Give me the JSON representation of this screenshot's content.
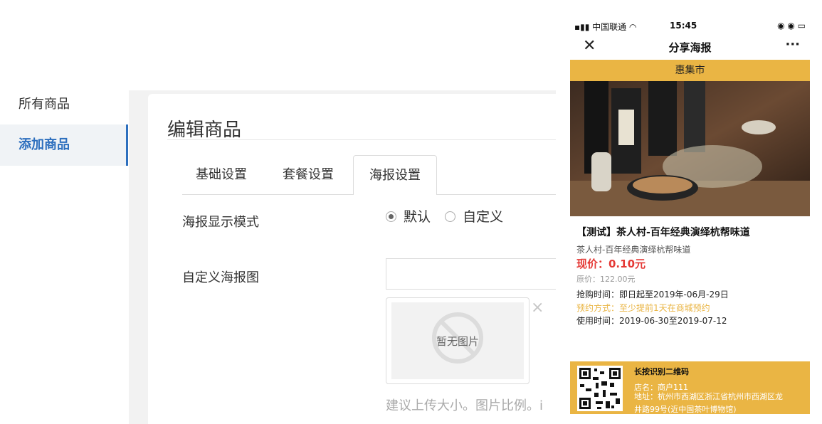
{
  "sidebar": {
    "items": [
      {
        "label": "所有商品"
      },
      {
        "label": "添加商品"
      }
    ]
  },
  "page": {
    "title": "编辑商品"
  },
  "tabs": [
    {
      "label": "基础设置"
    },
    {
      "label": "套餐设置"
    },
    {
      "label": "海报设置"
    }
  ],
  "form": {
    "mode_label": "海报显示模式",
    "mode_options": [
      {
        "label": "默认",
        "checked": true
      },
      {
        "label": "自定义",
        "checked": false
      }
    ],
    "custom_label": "自定义海报图",
    "custom_input_value": "",
    "no_image_text": "暂无图片",
    "remove_symbol": "×",
    "hint": "建议上传大小。图片比例。",
    "hint_visible": "建议上传大小。图片比例。i"
  },
  "phone": {
    "status": {
      "carrier": "中国联通",
      "time": "15:45"
    },
    "title": "分享海报",
    "close_symbol": "✕",
    "more_symbol": "···",
    "shop_name": "惠集市",
    "product_title": "【测试】茶人村-百年经典演绎杭帮味道",
    "product_subtitle": "茶人村-百年经典演绎杭帮味道",
    "price_now": "现价：0.10元",
    "price_original": "原价：122.00元",
    "purchase_time": "抢购时间：即日起至2019年-06月-29日",
    "booking": "预约方式：至少提前1天在商城预约",
    "use_time": "使用时间：2019-06-30至2019-07-12",
    "qr_title": "长按识别二维码",
    "store": "店名：商户111",
    "address_line1": "地址：杭州市西湖区浙江省杭州市西湖区龙",
    "address_line2": "井路99号(近中国茶叶博物馆)"
  },
  "colors": {
    "accent": "#2d6fbe",
    "poster_yellow": "#eab544",
    "price_red": "#e53935"
  }
}
